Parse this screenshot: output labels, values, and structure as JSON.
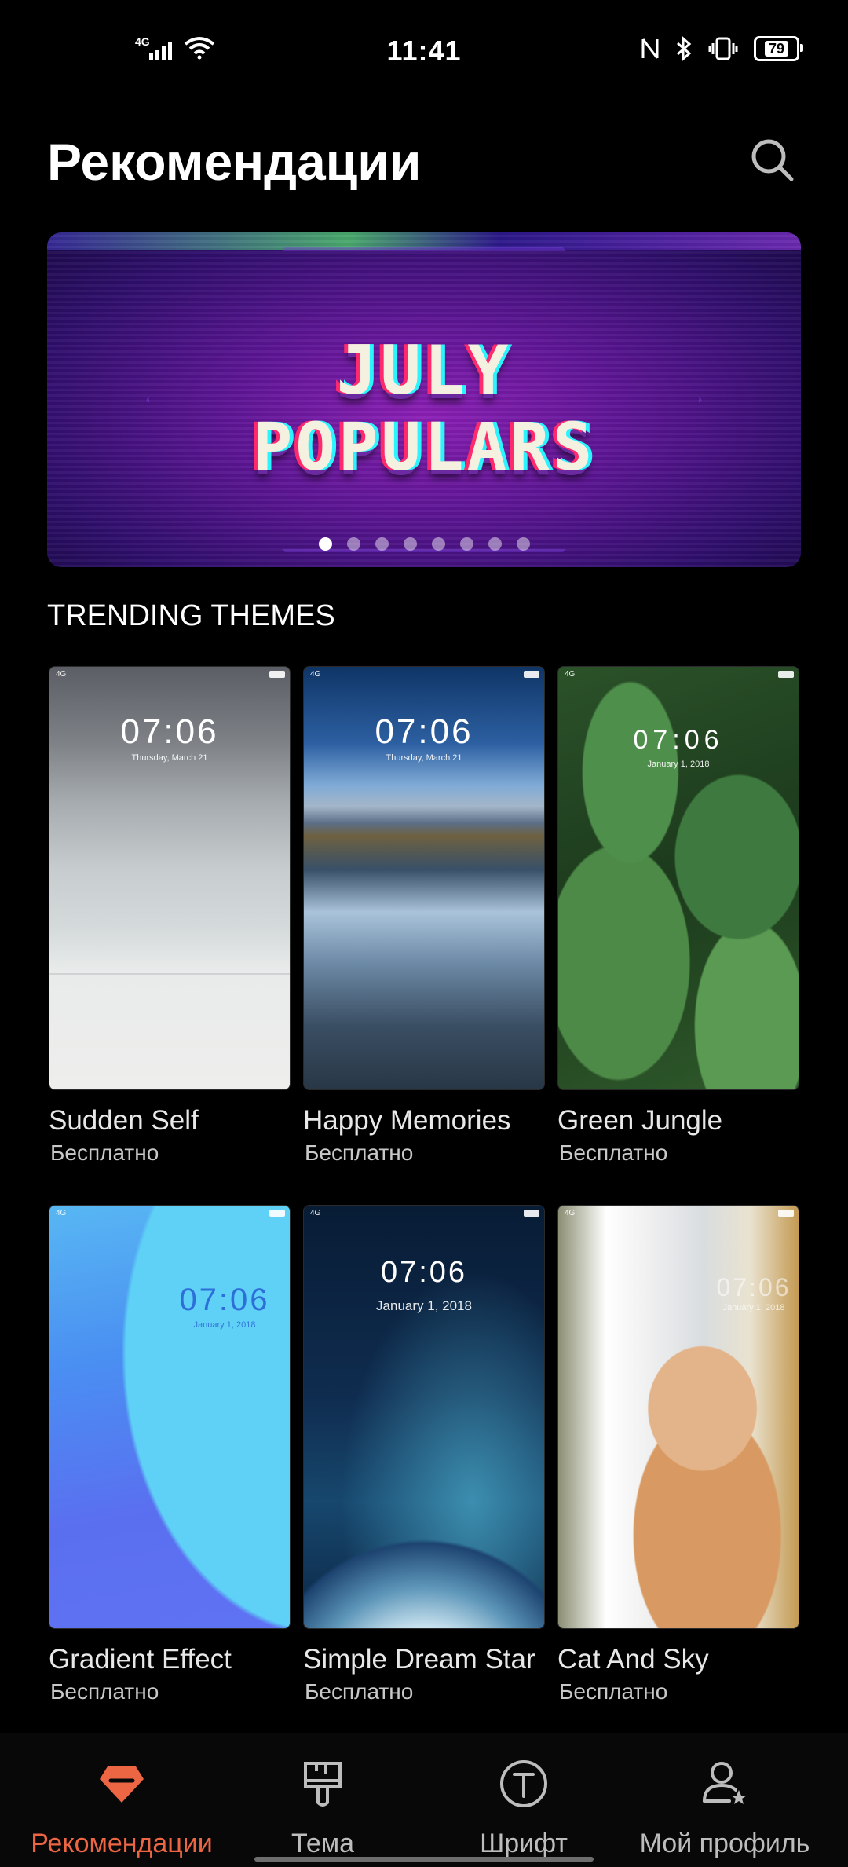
{
  "status_bar": {
    "time": "11:41",
    "network": "4G",
    "battery": "79",
    "icons": [
      "signal-icon",
      "wifi-icon",
      "nfc-icon",
      "bluetooth-icon",
      "vibrate-icon",
      "battery-icon"
    ]
  },
  "header": {
    "title": "Рекомендации",
    "search_icon": "search-icon"
  },
  "banner": {
    "line1": "JULY",
    "line2": "POPULARS",
    "page_count": 8,
    "active_page": 1
  },
  "section": {
    "title": "TRENDING THEMES"
  },
  "themes": [
    {
      "name": "Sudden Self",
      "price": "Бесплатно",
      "clock": "07:06",
      "date": "Thursday, March 21"
    },
    {
      "name": "Happy Memories",
      "price": "Бесплатно",
      "clock": "07:06",
      "date": "Thursday, March 21"
    },
    {
      "name": "Green Jungle",
      "price": "Бесплатно",
      "clock": "07:06",
      "date": "January 1, 2018"
    },
    {
      "name": "Gradient Effect",
      "price": "Бесплатно",
      "clock": "07:06",
      "date": "January 1, 2018"
    },
    {
      "name": "Simple Dream Star",
      "price": "Бесплатно",
      "clock": "07:06",
      "date": "January 1, 2018"
    },
    {
      "name": "Cat And Sky",
      "price": "Бесплатно",
      "clock": "07:06",
      "date": "January 1, 2018"
    }
  ],
  "bottom_nav": {
    "items": [
      {
        "label": "Рекомендации",
        "icon": "diamond-icon",
        "active": true
      },
      {
        "label": "Тема",
        "icon": "brush-icon",
        "active": false
      },
      {
        "label": "Шрифт",
        "icon": "font-icon",
        "active": false
      },
      {
        "label": "Мой профиль",
        "icon": "profile-icon",
        "active": false
      }
    ]
  },
  "colors": {
    "accent": "#ec6644",
    "background": "#000000",
    "nav_inactive": "#bdbdbd"
  }
}
